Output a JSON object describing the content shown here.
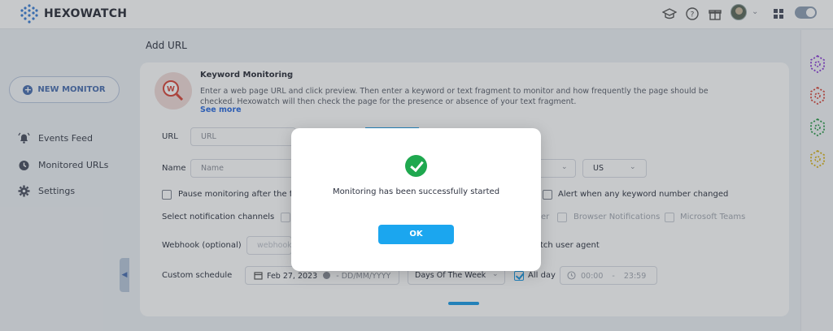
{
  "header": {
    "brand": "HEXOWATCH",
    "icons": [
      "graduation-cap-icon",
      "help-circle-icon",
      "gift-icon",
      "avatar",
      "chevron-down-icon",
      "apps-grid-icon",
      "toggle-switch"
    ]
  },
  "sidebar": {
    "new_monitor_label": "NEW MONITOR",
    "items": [
      {
        "label": "Events Feed",
        "icon": "bell-icon"
      },
      {
        "label": "Monitored URLs",
        "icon": "clock-icon"
      },
      {
        "label": "Settings",
        "icon": "gear-icon"
      }
    ]
  },
  "main": {
    "page_title": "Add URL",
    "monitor_type": "Keyword Monitoring",
    "description": "Enter a web page URL and click preview. Then enter a keyword or text fragment to monitor and how frequently the page should be checked. Hexowatch will then check the page for the presence or absence of your text fragment.",
    "see_more": "See more",
    "url_label": "URL",
    "url_placeholder": "URL",
    "name_label": "Name",
    "name_placeholder": "Name",
    "location_value": "US",
    "pause_label": "Pause monitoring after the firs",
    "alert_label": "Alert when any keyword number changed",
    "notification_label": "Select notification channels",
    "channel_fragment": "er",
    "channel_browser": "Browser Notifications",
    "channel_teams": "Microsoft Teams",
    "webhook_label": "Webhook (optional)",
    "webhook_placeholder": "webhook",
    "user_agent_fragment": "tch user agent",
    "schedule_label": "Custom schedule",
    "schedule_start": "Feb 27, 2023",
    "schedule_end_placeholder": "DD/MM/YYYY",
    "schedule_dash": "-",
    "days_select": "Days Of The Week",
    "all_day_label": "All day",
    "all_day_checked": true,
    "time_start": "00:00",
    "time_sep": "-",
    "time_end": "23:59"
  },
  "modal": {
    "message": "Monitoring has been successfully started",
    "ok_label": "OK"
  },
  "colors": {
    "accent": "#1ba6ef",
    "success": "#1fa84f",
    "brand_blue": "#4a6fb0",
    "link": "#2d6cdf"
  }
}
